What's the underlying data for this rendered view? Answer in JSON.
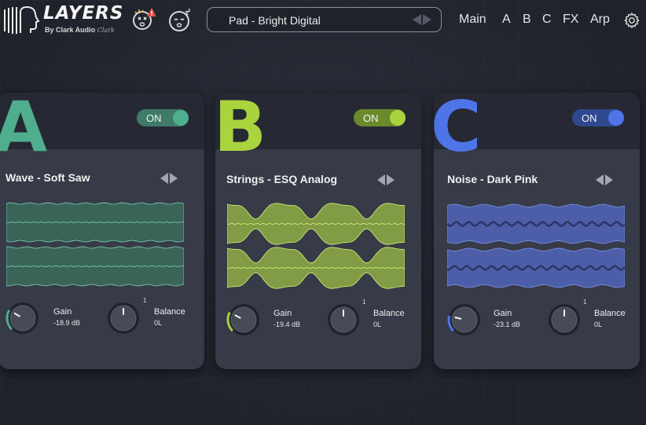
{
  "app": {
    "logo_text": "LAYERS",
    "logo_subtitle": "By Clark Audio",
    "logo_signature": "Clark"
  },
  "header": {
    "preset_name": "Pad - Bright Digital",
    "nav": [
      "Main",
      "A",
      "B",
      "C",
      "FX",
      "Arp"
    ],
    "icons": [
      "randomize-icon",
      "sleep-icon",
      "settings-icon"
    ]
  },
  "panels": [
    {
      "letter": "A",
      "toggle": "ON",
      "wave_name": "Wave - Soft Saw",
      "accent": "#4fae8d",
      "toggle_bg": "#3f7b68",
      "knob_dot": "#4fae8d",
      "wave_fill": "#3a6457",
      "wave_line": "#7dd3bb",
      "gain_label": "Gain",
      "gain_value": "-18.9 dB",
      "gain_level": 0.28,
      "balance_label": "Balance",
      "balance_value": "0L",
      "balance_top": "1"
    },
    {
      "letter": "B",
      "toggle": "ON",
      "wave_name": "Strings - ESQ Analog",
      "accent": "#a9d43e",
      "toggle_bg": "#6b8a2c",
      "knob_dot": "#a9d43e",
      "wave_fill": "#819c45",
      "wave_line": "#d6ef7a",
      "gain_label": "Gain",
      "gain_value": "-19.4 dB",
      "gain_level": 0.27,
      "balance_label": "Balance",
      "balance_value": "0L",
      "balance_top": "1"
    },
    {
      "letter": "C",
      "toggle": "ON",
      "wave_name": "Noise - Dark Pink",
      "accent": "#4f74e8",
      "toggle_bg": "#30488f",
      "knob_dot": "#4f74e8",
      "wave_fill": "#4c5ea7",
      "wave_line": "#7f94e8",
      "gain_label": "Gain",
      "gain_value": "-23.1 dB",
      "gain_level": 0.22,
      "balance_label": "Balance",
      "balance_value": "0L",
      "balance_top": "1"
    }
  ]
}
